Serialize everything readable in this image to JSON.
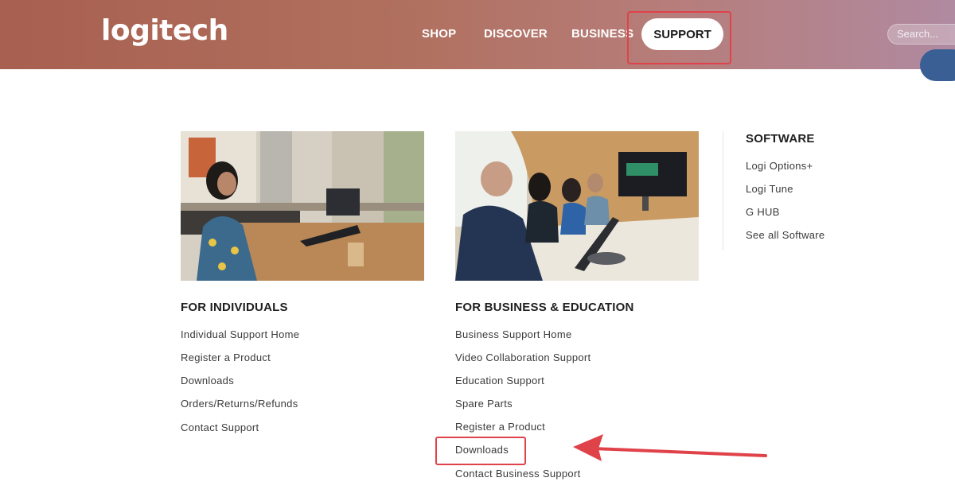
{
  "header": {
    "logo": "logitech",
    "nav": [
      {
        "label": "SHOP"
      },
      {
        "label": "DISCOVER"
      },
      {
        "label": "BUSINESS"
      },
      {
        "label": "SUPPORT"
      }
    ],
    "search_placeholder": "Search..."
  },
  "individuals": {
    "heading": "FOR INDIVIDUALS",
    "links": [
      "Individual Support Home",
      "Register a Product",
      "Downloads",
      "Orders/Returns/Refunds",
      "Contact Support"
    ]
  },
  "business": {
    "heading": "FOR BUSINESS & EDUCATION",
    "links": [
      "Business Support Home",
      "Video Collaboration Support",
      "Education Support",
      "Spare Parts",
      "Register a Product",
      "Downloads",
      "Contact Business Support"
    ]
  },
  "software": {
    "heading": "SOFTWARE",
    "links": [
      "Logi Options+",
      "Logi Tune",
      "G HUB",
      "See all Software"
    ]
  },
  "colors": {
    "header_start": "#a86050",
    "header_end": "#b08aa0",
    "annotation_red": "#e0424a"
  }
}
